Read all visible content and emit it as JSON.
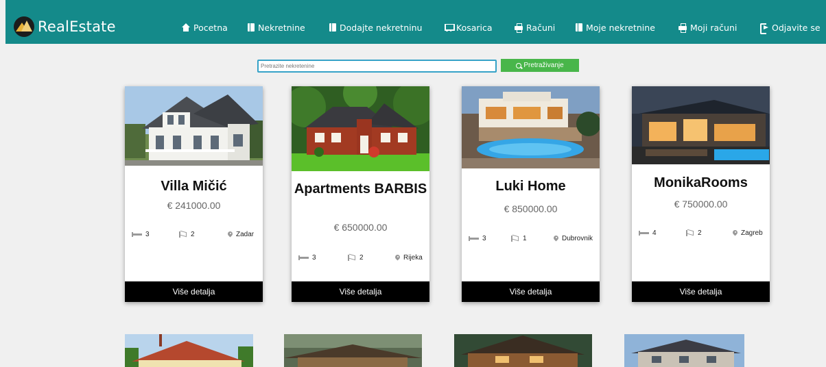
{
  "brand": {
    "name": "RealEstate"
  },
  "nav": [
    {
      "label": "Pocetna",
      "icon": "home-icon"
    },
    {
      "label": "Nekretnine",
      "icon": "book-icon"
    },
    {
      "label": "Dodajte nekretninu",
      "icon": "book-icon"
    },
    {
      "label": "Kosarica",
      "icon": "cart-icon"
    },
    {
      "label": "Računi",
      "icon": "print-icon"
    },
    {
      "label": "Moje nekretnine",
      "icon": "book-icon"
    },
    {
      "label": "Moji računi",
      "icon": "print-icon"
    },
    {
      "label": "Odjavite se",
      "icon": "sign-out-icon"
    }
  ],
  "search": {
    "placeholder": "Pretrazite nekretenine",
    "button_label": "Pretraživanje"
  },
  "cards": [
    {
      "title": "Villa Mičić",
      "price": "€ 241000.00",
      "beds": "3",
      "baths": "2",
      "city": "Zadar",
      "button": "Više detalja"
    },
    {
      "title": "Apartments BARBIS",
      "price": "€ 650000.00",
      "beds": "3",
      "baths": "2",
      "city": "Rijeka",
      "button": "Više detalja"
    },
    {
      "title": "Luki Home",
      "price": "€ 850000.00",
      "beds": "3",
      "baths": "1",
      "city": "Dubrovnik",
      "button": "Više detalja"
    },
    {
      "title": "MonikaRooms",
      "price": "€ 750000.00",
      "beds": "4",
      "baths": "2",
      "city": "Zagreb",
      "button": "Više detalja"
    }
  ],
  "colors": {
    "navbar": "#148a8a",
    "search_button": "#48b64a",
    "search_border": "#35a2c7",
    "detail_button": "#000000"
  }
}
